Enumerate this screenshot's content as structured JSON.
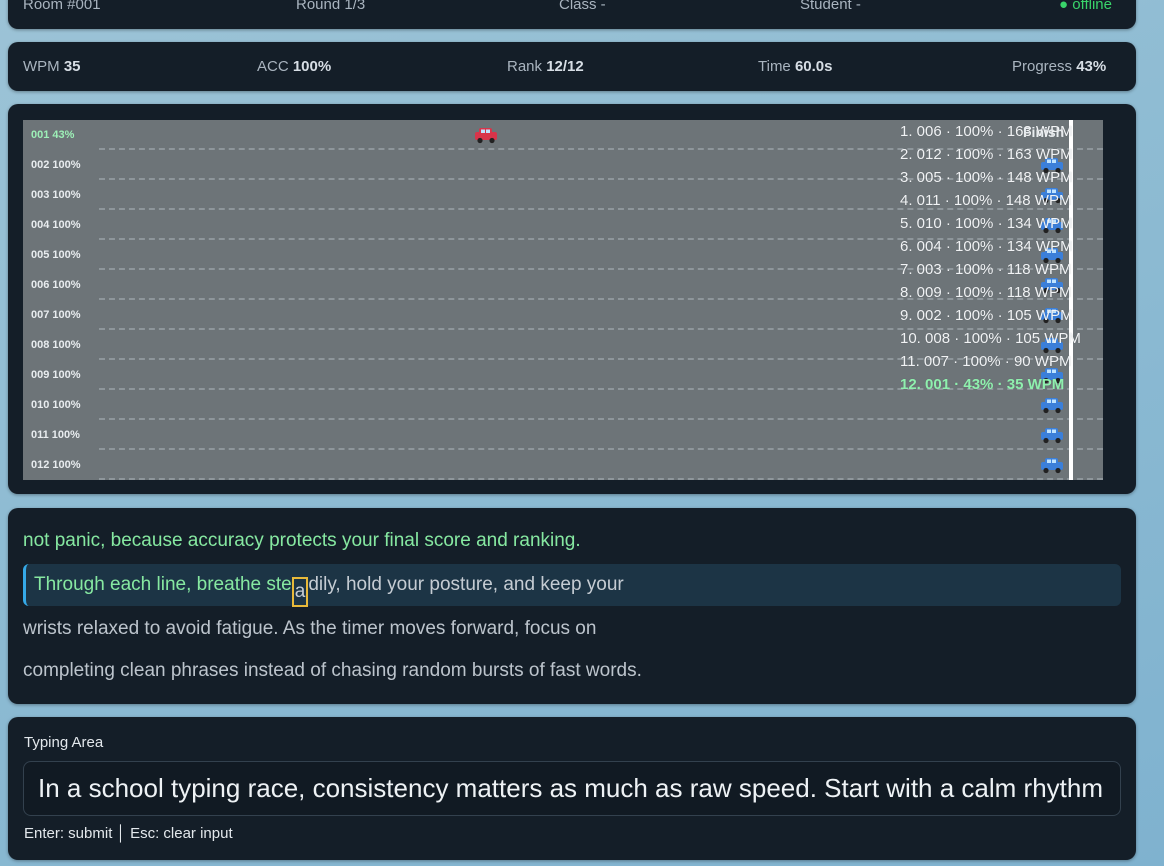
{
  "header": {
    "room": "Room #001",
    "round": "Round 1/3",
    "class": "Class -",
    "student": "Student -",
    "status": "● offline"
  },
  "stats": {
    "wpm_label": "WPM",
    "wpm_value": "35",
    "acc_label": "ACC",
    "acc_value": "100%",
    "rank_label": "Rank",
    "rank_value": "12/12",
    "time_label": "Time",
    "time_value": "60.0s",
    "progress_label": "Progress",
    "progress_value": "43%"
  },
  "race": {
    "finish_label": "Finish",
    "lanes": [
      {
        "label": "001 43%",
        "progress": 0.43,
        "me": true
      },
      {
        "label": "002 100%",
        "progress": 1.0,
        "me": false
      },
      {
        "label": "003 100%",
        "progress": 1.0,
        "me": false
      },
      {
        "label": "004 100%",
        "progress": 1.0,
        "me": false
      },
      {
        "label": "005 100%",
        "progress": 1.0,
        "me": false
      },
      {
        "label": "006 100%",
        "progress": 1.0,
        "me": false
      },
      {
        "label": "007 100%",
        "progress": 1.0,
        "me": false
      },
      {
        "label": "008 100%",
        "progress": 1.0,
        "me": false
      },
      {
        "label": "009 100%",
        "progress": 1.0,
        "me": false
      },
      {
        "label": "010 100%",
        "progress": 1.0,
        "me": false
      },
      {
        "label": "011 100%",
        "progress": 1.0,
        "me": false
      },
      {
        "label": "012 100%",
        "progress": 1.0,
        "me": false
      }
    ],
    "leaderboard": [
      {
        "text": "1. 006 · 100% · 163 WPM",
        "me": false
      },
      {
        "text": "2. 012 · 100% · 163 WPM",
        "me": false
      },
      {
        "text": "3. 005 · 100% · 148 WPM",
        "me": false
      },
      {
        "text": "4. 011 · 100% · 148 WPM",
        "me": false
      },
      {
        "text": "5. 010 · 100% · 134 WPM",
        "me": false
      },
      {
        "text": "6. 004 · 100% · 134 WPM",
        "me": false
      },
      {
        "text": "7. 003 · 100% · 118 WPM",
        "me": false
      },
      {
        "text": "8. 009 · 100% · 118 WPM",
        "me": false
      },
      {
        "text": "9. 002 · 100% · 105 WPM",
        "me": false
      },
      {
        "text": "10. 008 · 100% · 105 WPM",
        "me": false
      },
      {
        "text": "11. 007 · 100% · 90 WPM",
        "me": false
      },
      {
        "text": "12. 001 · 43% · 35 WPM",
        "me": true
      }
    ],
    "colors": {
      "my_car": "#d8344a",
      "other_car": "#3b7fd9"
    }
  },
  "passage": {
    "done_line": "not panic, because accuracy protects your final score and ranking.",
    "current_typed": "Through each line, breathe ste",
    "current_cursor": "a",
    "current_rest": "dily, hold your posture, and keep your",
    "next_line_1": "wrists relaxed to avoid fatigue. As the timer moves forward, focus on",
    "next_line_2": "completing clean phrases instead of chasing random bursts of fast words."
  },
  "typing": {
    "label": "Typing Area",
    "value": "In a school typing race, consistency matters as much as raw speed. Start with a calm rhythm",
    "hint": "Enter: submit │ Esc: clear input"
  }
}
